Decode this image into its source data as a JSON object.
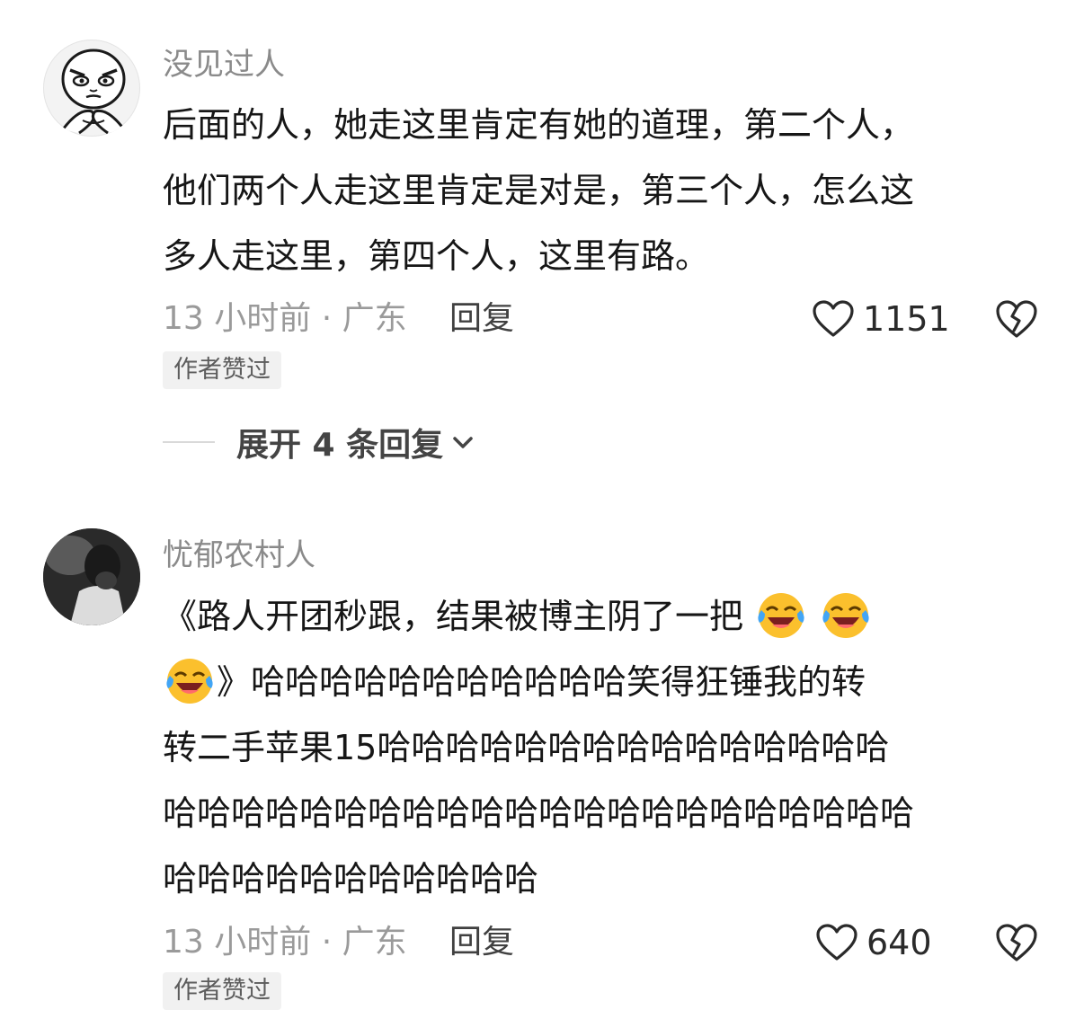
{
  "comments": [
    {
      "username": "没见过人",
      "avatar_icon": "rage-face-avatar",
      "content_lines": [
        "后面的人，她走这里肯定有她的道理，第二个人，",
        "他们两个人走这里肯定是对是，第三个人，怎么这",
        "多人走这里，第四个人，这里有路。"
      ],
      "time_location": "13 小时前 · 广东",
      "reply_label": "回复",
      "likes": "1151",
      "badge": "作者赞过",
      "expand_label": "展开 4 条回复"
    },
    {
      "username": "忧郁农村人",
      "avatar_icon": "photo-avatar",
      "content_line1_text": "《路人开团秒跟，结果被博主阴了一把",
      "content_line2_text": "》哈哈哈哈哈哈哈哈哈哈哈笑得狂锤我的转",
      "content_lines_rest": [
        "转二手苹果15哈哈哈哈哈哈哈哈哈哈哈哈哈哈哈",
        "哈哈哈哈哈哈哈哈哈哈哈哈哈哈哈哈哈哈哈哈哈哈",
        "哈哈哈哈哈哈哈哈哈哈哈"
      ],
      "emoji": "laughing-crying-emoji",
      "time_location": "13 小时前 · 广东",
      "reply_label": "回复",
      "likes": "640",
      "badge": "作者赞过"
    }
  ],
  "icons": {
    "like": "heart-outline-icon",
    "dislike": "broken-heart-icon",
    "expand": "chevron-down-icon"
  }
}
